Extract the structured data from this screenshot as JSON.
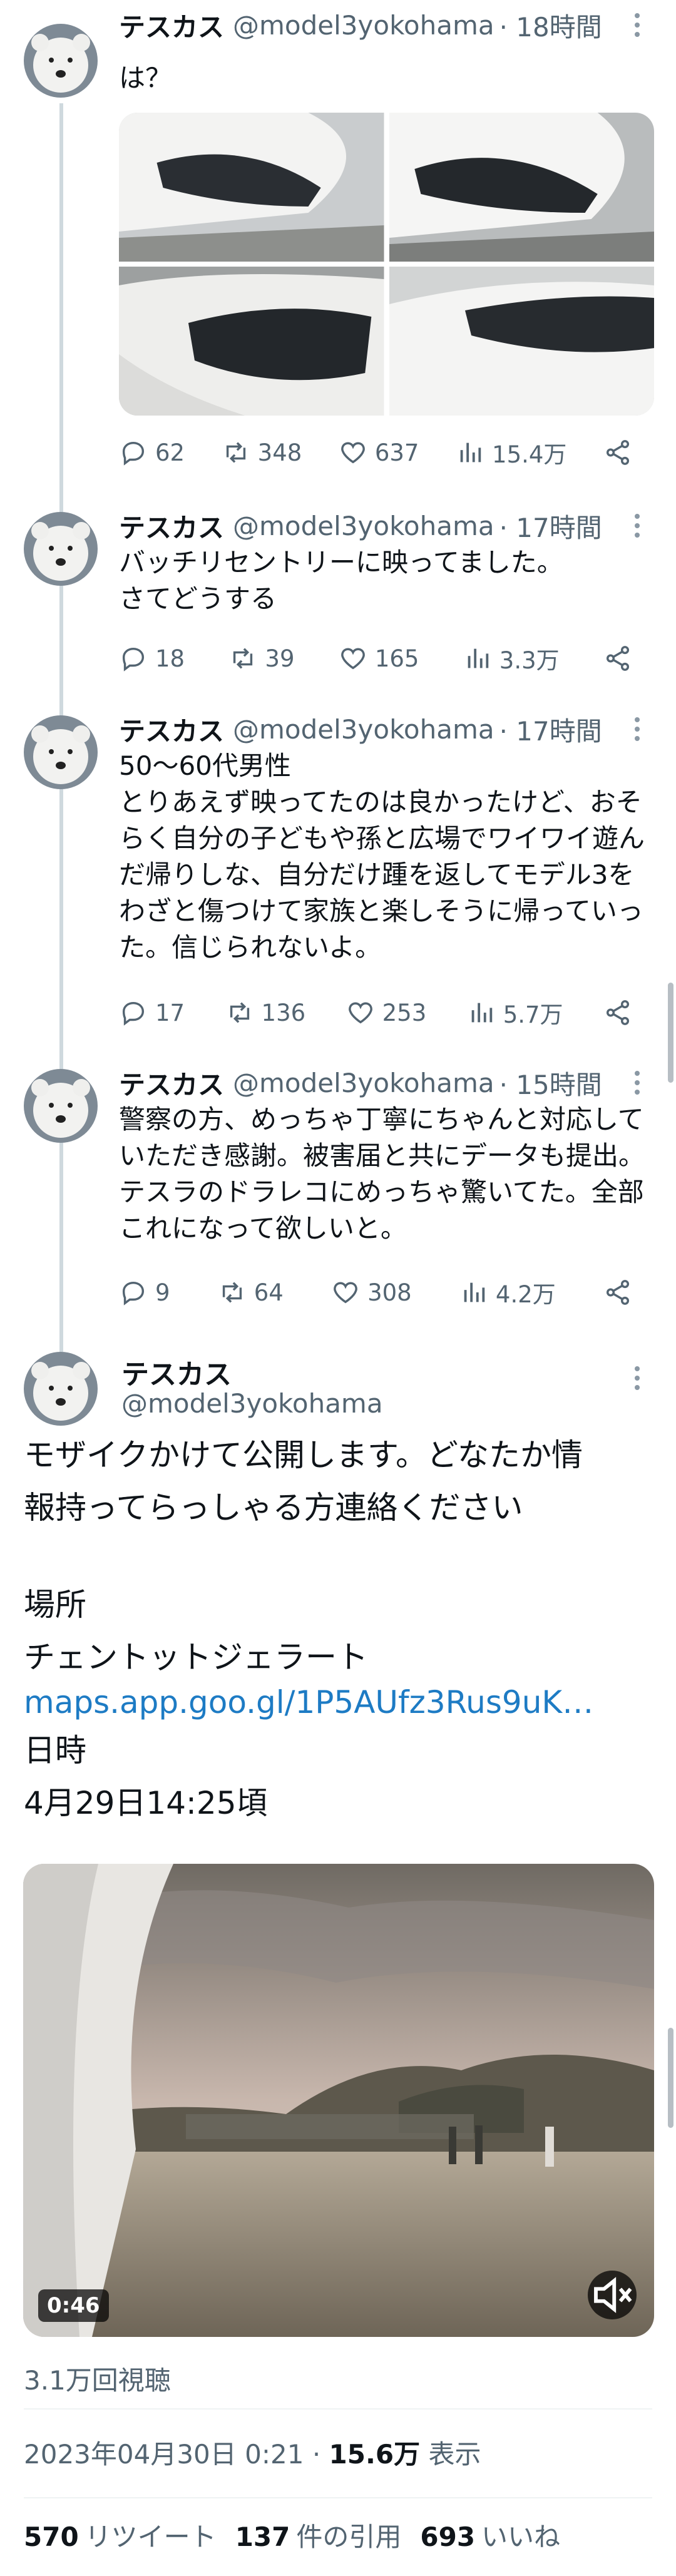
{
  "author": {
    "name": "テスカス",
    "handle": "@model3yokohama"
  },
  "thread": [
    {
      "time": "· 18時間",
      "text": "は？",
      "replies": "62",
      "retweets": "348",
      "likes": "637",
      "views": "15.4万"
    },
    {
      "time": "· 17時間",
      "text": "バッチリセントリーに映ってました。\nさてどうする",
      "replies": "18",
      "retweets": "39",
      "likes": "165",
      "views": "3.3万"
    },
    {
      "time": "· 17時間",
      "text": "50〜60代男性\nとりあえず映ってたのは良かったけど、おそらく自分の子どもや孫と広場でワイワイ遊んだ帰りしな、自分だけ踵を返してモデル3をわざと傷つけて家族と楽しそうに帰っていった。信じられないよ。",
      "replies": "17",
      "retweets": "136",
      "likes": "253",
      "views": "5.7万"
    },
    {
      "time": "· 15時間",
      "text": "警察の方、めっちゃ丁寧にちゃんと対応していただき感謝。被害届と共にデータも提出。テスラのドラレコにめっちゃ驚いてた。全部これになって欲しいと。",
      "replies": "9",
      "retweets": "64",
      "likes": "308",
      "views": "4.2万"
    }
  ],
  "main_tweet": {
    "line1": "モザイクかけて公開します。どなたか情",
    "line2": "報持ってらっしゃる方連絡ください",
    "place_label": "場所",
    "place_name": "チェントットジェラート",
    "link": "maps.app.goo.gl/1P5AUfz3Rus9uK…",
    "date_label": "日時",
    "date_value": "4月29日14:25頃",
    "video_duration": "0:46",
    "video_views": "3.1万回視聴",
    "timestamp": "2023年04月30日 0:21",
    "impressions": "15.6万",
    "impressions_label": "表示",
    "retweets": "570",
    "retweets_label": "リツイート",
    "quotes": "137",
    "quotes_label": "件の引用",
    "likes": "693",
    "likes_label": "いいね"
  },
  "colors": {
    "text": "#0f1419",
    "secondary": "#536471",
    "link": "#1d7bc4",
    "thread_line": "#cfd9de"
  }
}
